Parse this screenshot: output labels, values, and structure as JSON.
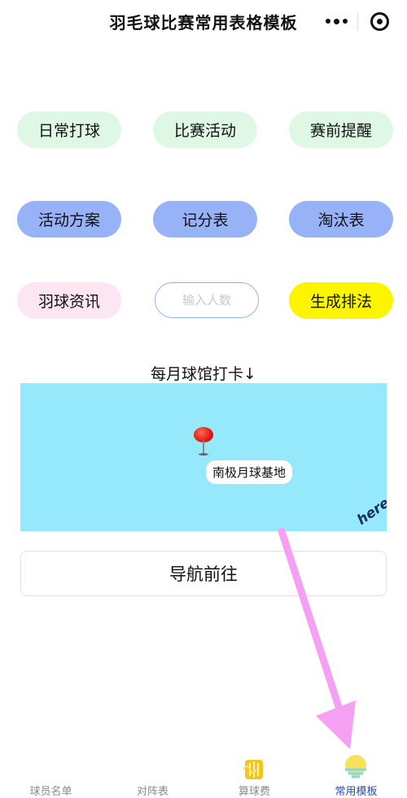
{
  "header": {
    "title": "羽毛球比赛常用表格模板"
  },
  "buttons": {
    "row1": [
      "日常打球",
      "比赛活动",
      "赛前提醒"
    ],
    "row2": [
      "活动方案",
      "记分表",
      "淘汰表"
    ],
    "row3_left": "羽球资讯",
    "row3_right": "生成排法"
  },
  "player_count_input": {
    "placeholder": "输入人数",
    "value": ""
  },
  "checkin": {
    "label": "每月球馆打卡↓"
  },
  "map": {
    "location_name": "南极月球基地",
    "provider_logo": "here"
  },
  "navigate_button": "导航前往",
  "tabbar": {
    "tabs": [
      {
        "label": "球员名单",
        "icon": "crescent-moon-icon"
      },
      {
        "label": "对阵表",
        "icon": "crescent-moon-icon"
      },
      {
        "label": "算球费",
        "icon": "coins-icon"
      },
      {
        "label": "常用模板",
        "icon": "template-icon",
        "active": true
      }
    ]
  },
  "colors": {
    "green_pill": "#dff8e6",
    "blue_pill": "#97b2f6",
    "pink_pill": "#fde6f3",
    "yellow_pill": "#fdf500",
    "map_bg": "#95e9fb",
    "annotation_arrow": "#f5a0f2"
  }
}
